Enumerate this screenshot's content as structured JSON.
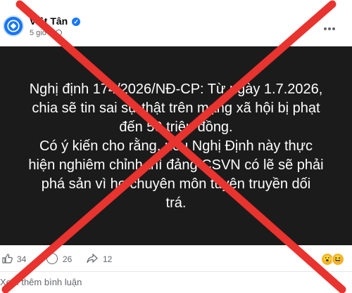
{
  "post": {
    "author": "Việt Tân",
    "time": "5 giờ ·",
    "text": "Nghị định 174/2026/NĐ-CP: Từ ngày 1.7.2026,\nchia sẽ tin sai sự thật trên mạng xã hội bị phạt\nđến 50 triệu đồng.\nCó ý kiến cho rằng, nếu Nghị Định này thực\nhiện nghiêm chỉnh thì đảng CSVN có lẽ sẽ phải\nphá sản vì họ chuyên môn tuyên truyền dối\ntrá."
  },
  "stats": {
    "likes": "34",
    "comments": "26",
    "shares": "12"
  },
  "footer": {
    "see_more_comments": "Xem thêm bình luận"
  },
  "overlay": {
    "cross_color": "#e8332e"
  },
  "icons": [
    "verified-icon",
    "globe-icon",
    "more-options-icon",
    "like-icon",
    "comment-icon",
    "share-icon",
    "reaction-emoji-icon"
  ]
}
